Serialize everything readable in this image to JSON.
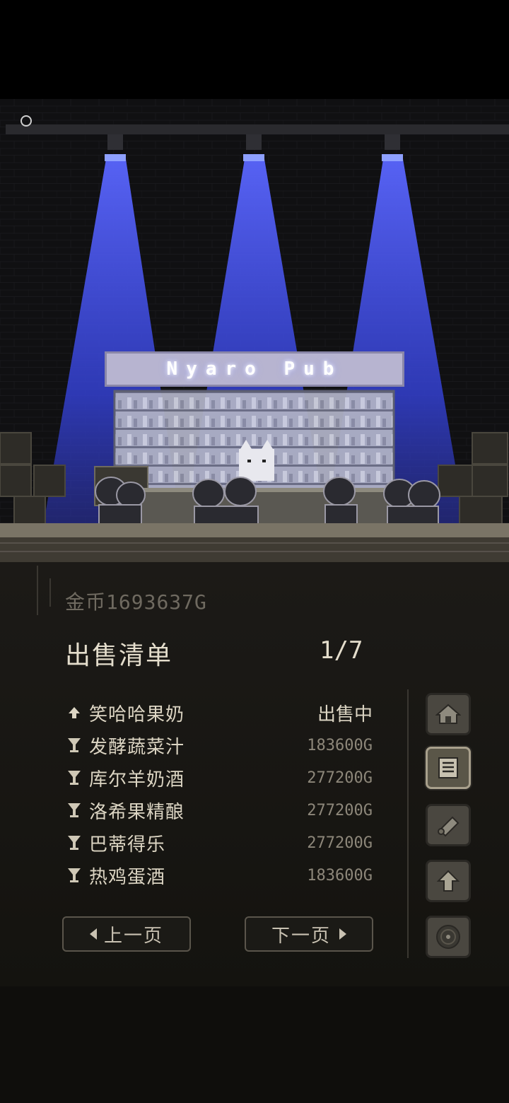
{
  "scene": {
    "sign_text": "Nyaro Pub"
  },
  "gold": {
    "label": "金币",
    "amount": "1693637G"
  },
  "sale_list": {
    "title": "出售清单",
    "page": "1/7",
    "items": [
      {
        "icon": "up-arrow-icon",
        "name": "笑哈哈果奶",
        "status": "出售中",
        "price": ""
      },
      {
        "icon": "goblet-icon",
        "name": "发酵蔬菜汁",
        "status": "",
        "price": "183600G"
      },
      {
        "icon": "goblet-icon",
        "name": "库尔羊奶酒",
        "status": "",
        "price": "277200G"
      },
      {
        "icon": "goblet-icon",
        "name": "洛希果精酿",
        "status": "",
        "price": "277200G"
      },
      {
        "icon": "goblet-icon",
        "name": "巴蒂得乐",
        "status": "",
        "price": "277200G"
      },
      {
        "icon": "goblet-icon",
        "name": "热鸡蛋酒",
        "status": "",
        "price": "183600G"
      }
    ]
  },
  "pager": {
    "prev_label": "上一页",
    "next_label": "下一页"
  },
  "side_menu": [
    {
      "icon": "house-icon",
      "active": false
    },
    {
      "icon": "list-icon",
      "active": true
    },
    {
      "icon": "scroll-icon",
      "active": false
    },
    {
      "icon": "up-arrow-icon",
      "active": false
    },
    {
      "icon": "record-icon",
      "active": false
    }
  ],
  "colors": {
    "spotlight": "#3a44d8",
    "panel_bg": "#1c1a17",
    "text_primary": "#e4ddcc",
    "text_muted": "#8d877a"
  }
}
